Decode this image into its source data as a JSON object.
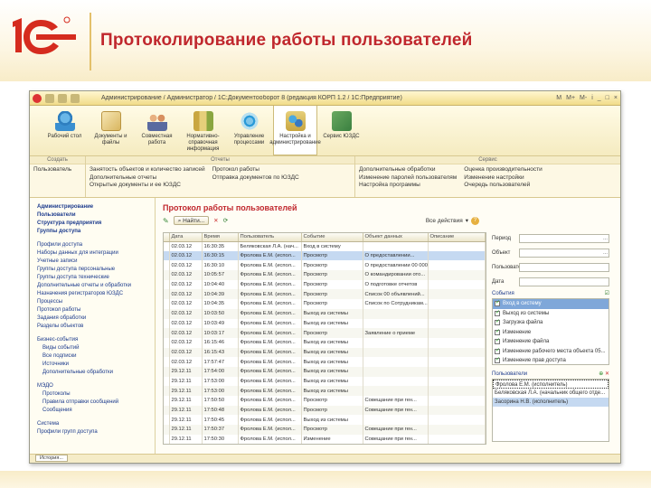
{
  "slide": {
    "title": "Протоколирование работы пользователей",
    "colors": {
      "brand_red": "#c0272d",
      "brand_gold": "#e3c06a"
    }
  },
  "window": {
    "title": "Администрирование / Администратор / 1С:Документооборот 8 (редакция КОРП 1.2 / 1С:Предприятие)",
    "icons": [
      "back-icon",
      "forward-icon",
      "home-icon"
    ],
    "controls": [
      "M",
      "M+",
      "M-",
      "i",
      "_",
      "□",
      "×"
    ]
  },
  "sections": [
    {
      "label": "Рабочий стол",
      "icon": "desktop-icon"
    },
    {
      "label": "Документы и файлы",
      "icon": "documents-icon"
    },
    {
      "label": "Совместная работа",
      "icon": "collaboration-icon"
    },
    {
      "label": "Нормативно-справочная информация",
      "icon": "reference-icon"
    },
    {
      "label": "Управление процессами",
      "icon": "processes-icon"
    },
    {
      "label": "Настройка и администрирование",
      "icon": "settings-icon"
    },
    {
      "label": "Сервис ЮЗДС",
      "icon": "service-icon"
    }
  ],
  "panel": {
    "groups": [
      {
        "title": "Создать",
        "cols": [
          [
            "Пользователь"
          ]
        ]
      },
      {
        "title": "Отчеты",
        "cols": [
          [
            "Занятость объектов и количество записей",
            "Дополнительные отчеты",
            "Открытые документы и ее ЮЗДС"
          ],
          [
            "Протокол работы",
            "Отправка документов по ЮЗДС"
          ]
        ]
      },
      {
        "title": "Сервис",
        "cols": [
          [
            "Дополнительные обработки",
            "Изменение паролей пользователям",
            "Настройка программы"
          ],
          [
            "Оценка производительности",
            "Изменение настройки",
            "Очередь пользователей"
          ]
        ]
      }
    ]
  },
  "nav": {
    "top": [
      "Администрирование",
      "Пользователи",
      "Структура предприятия",
      "Группы доступа"
    ],
    "items": [
      "Профили доступа",
      "Наборы данных для интеграции",
      "Учетные записи",
      "Группы доступа персональные",
      "Группы доступа технические",
      "Дополнительные отчеты и обработки",
      "Назначения регистраторов ЮЗДС",
      "Процессы",
      "Протокол работы",
      "Задания обработки",
      "Разделы объектов"
    ],
    "group1": {
      "title": "Бизнес-события",
      "items": [
        "Виды событий",
        "Все подписки",
        "Источники",
        "Дополнительные обработки"
      ]
    },
    "group2": {
      "title": "МЭДО",
      "items": [
        "Протоколы",
        "Правила отправки сообщений",
        "Сообщения"
      ]
    },
    "group3": {
      "title": "Система",
      "items": [
        "Профили групп доступа"
      ]
    }
  },
  "form": {
    "title": "Протокол работы пользователей",
    "refresh_label": "Найти...",
    "actions_label": "Все действия"
  },
  "grid": {
    "columns": [
      "Дата",
      "Время",
      "Пользователь",
      "Событие",
      "Объект данных",
      "Описание"
    ],
    "rows": [
      [
        "02.03.12",
        "16:30:35",
        "Беляковская Л.А. (нач...",
        "Вход в систему",
        "",
        ""
      ],
      [
        "02.03.12",
        "16:30:15",
        "Фролова Е.М. (испол...",
        "Просмотр",
        "О предоставлении...",
        ""
      ],
      [
        "02.03.12",
        "16:30:10",
        "Фролова Е.М. (испол...",
        "Просмотр",
        "О предоставлении 00 000...",
        ""
      ],
      [
        "02.03.12",
        "10:05:57",
        "Фролова Е.М. (испол...",
        "Просмотр",
        "О командировании ото...",
        ""
      ],
      [
        "02.03.12",
        "10:04:40",
        "Фролова Е.М. (испол...",
        "Просмотр",
        "О подготовке отчетов",
        ""
      ],
      [
        "02.03.12",
        "10:04:39",
        "Фролова Е.М. (испол...",
        "Просмотр",
        "Список 00 объявлений...",
        ""
      ],
      [
        "02.03.12",
        "10:04:35",
        "Фролова Е.М. (испол...",
        "Просмотр",
        "Список по Сотрудникам...",
        ""
      ],
      [
        "02.03.12",
        "10:03:50",
        "Фролова Е.М. (испол...",
        "Выход из системы",
        "",
        ""
      ],
      [
        "02.03.12",
        "10:03:49",
        "Фролова Е.М. (испол...",
        "Выход из системы",
        "",
        ""
      ],
      [
        "02.03.12",
        "10:03:17",
        "Фролова Е.М. (испол...",
        "Просмотр",
        "Заявление о приеме",
        ""
      ],
      [
        "02.03.12",
        "16:15:46",
        "Фролова Е.М. (испол...",
        "Выход из системы",
        "",
        ""
      ],
      [
        "02.03.12",
        "16:15:43",
        "Фролова Е.М. (испол...",
        "Выход из системы",
        "",
        ""
      ],
      [
        "02.03.12",
        "17:57:47",
        "Фролова Е.М. (испол...",
        "Выход из системы",
        "",
        ""
      ],
      [
        "29.12.11",
        "17:54:00",
        "Фролова Е.М. (испол...",
        "Выход из системы",
        "",
        ""
      ],
      [
        "29.12.11",
        "17:53:00",
        "Фролова Е.М. (испол...",
        "Выход из системы",
        "",
        ""
      ],
      [
        "29.12.11",
        "17:53:00",
        "Фролова Е.М. (испол...",
        "Выход из системы",
        "",
        ""
      ],
      [
        "29.12.11",
        "17:50:50",
        "Фролова Е.М. (испол...",
        "Просмотр",
        "Совещание при ген...",
        ""
      ],
      [
        "29.12.11",
        "17:50:48",
        "Фролова Е.М. (испол...",
        "Просмотр",
        "Совещание при ген...",
        ""
      ],
      [
        "29.12.11",
        "17:50:45",
        "Фролова Е.М. (испол...",
        "Выход из системы",
        "",
        ""
      ],
      [
        "29.12.11",
        "17:50:37",
        "Фролова Е.М. (испол...",
        "Просмотр",
        "Совещание при ген...",
        ""
      ],
      [
        "29.12.11",
        "17:50:30",
        "Фролова Е.М. (испол...",
        "Изменение",
        "Совещание при ген...",
        ""
      ]
    ],
    "selected_row": 1
  },
  "filter": {
    "fields": [
      "Период",
      "Объект",
      "Пользователь",
      "Дата"
    ],
    "events_title": "События",
    "events": [
      "Вход в систему",
      "Выход из системы",
      "Загрузка файла",
      "Изменение",
      "Изменение файла",
      "Изменение рабочего места объекта 05...",
      "Изменение прав доступа"
    ],
    "users_title": "Пользователи",
    "users": [
      "Фролова Е.М. (исполнитель)",
      "Беляковская Л.А. (начальник общего отде...",
      "Засорина Н.В. (исполнитель)"
    ]
  },
  "status": {
    "history_label": "История..."
  }
}
